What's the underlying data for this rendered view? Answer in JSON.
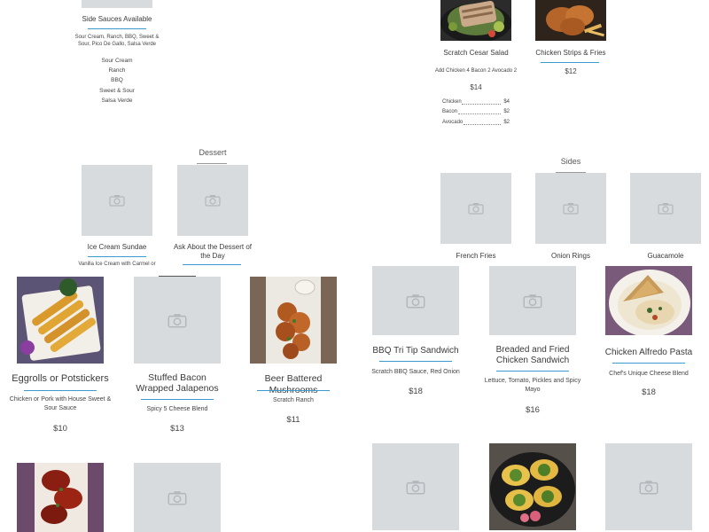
{
  "side_sauces": {
    "title": "Side Sauces Available",
    "desc": "Sour Cream, Ranch, BBQ, Sweet & Sour, Pico De Gallo, Salsa Verde",
    "items": [
      "Sour Cream",
      "Ranch",
      "BBQ",
      "Sweet & Sour",
      "Salsa Verde"
    ]
  },
  "salad": {
    "title": "Scratch Cesar Salad",
    "desc": "Add Chicken 4 Bacon 2 Avocado 2",
    "price": "$14",
    "addons": [
      {
        "name": "Chicken",
        "price": "$4"
      },
      {
        "name": "Bacon",
        "price": "$2"
      },
      {
        "name": "Avocado",
        "price": "$2"
      }
    ]
  },
  "chicken_strips": {
    "title": "Chicken Strips & Fries",
    "price": "$12"
  },
  "dessert": {
    "heading": "Dessert",
    "items": [
      {
        "title": "Ice Cream Sundae",
        "desc": "Vanilla Ice Cream with Carmel or"
      },
      {
        "title": "Ask About the Dessert of the Day"
      }
    ]
  },
  "sides": {
    "heading": "Sides",
    "items": [
      {
        "title": "French Fries"
      },
      {
        "title": "Onion Rings"
      },
      {
        "title": "Guacamole"
      }
    ]
  },
  "appetizers": [
    {
      "title": "Eggrolls or Potstickers",
      "desc": "Chicken or Pork with House Sweet & Sour Sauce",
      "price": "$10"
    },
    {
      "title": "Stuffed Bacon Wrapped Jalapenos",
      "desc": "Spicy 5 Cheese Blend",
      "price": "$13"
    },
    {
      "title": "Beer Battered Mushrooms",
      "desc": "Scratch Ranch",
      "price": "$11"
    }
  ],
  "mains": [
    {
      "title": "BBQ Tri Tip Sandwich",
      "desc": "Scratch BBQ Sauce, Red Onion",
      "price": "$18"
    },
    {
      "title": "Breaded and Fried Chicken Sandwich",
      "desc": "Lettuce, Tomato, Pickles and Spicy Mayo",
      "price": "$16"
    },
    {
      "title": "Chicken Alfredo Pasta",
      "desc": "Chef's Unique Cheese Blend",
      "price": "$18"
    }
  ],
  "colors": {
    "accent": "#3b9bd1",
    "placeholder": "#d8dbde"
  }
}
